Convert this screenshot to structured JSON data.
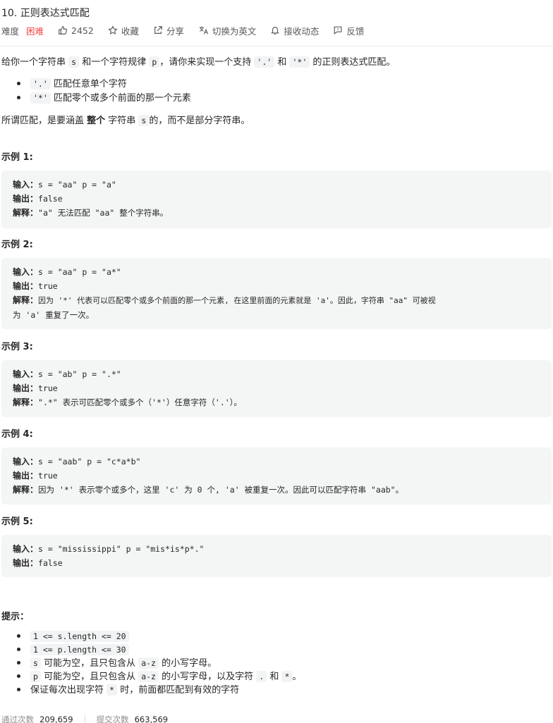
{
  "problem": {
    "title": "10. 正则表达式匹配",
    "difficulty_label": "难度",
    "difficulty": "困难",
    "likes": "2452",
    "favorite_label": "收藏",
    "share_label": "分享",
    "switch_lang_label": "切换为英文",
    "follow_label": "接收动态",
    "feedback_label": "反馈"
  },
  "description": {
    "p1": [
      "给你一个字符串 ",
      "s",
      " 和一个字符规律 ",
      "p",
      "，请你来实现一个支持 ",
      "'.'",
      " 和 ",
      "'*'",
      " 的正则表达式匹配。"
    ],
    "bullets": [
      {
        "code": "'.'",
        "text": " 匹配任意单个字符"
      },
      {
        "code": "'*'",
        "text": " 匹配零个或多个前面的那一个元素"
      }
    ],
    "scope": [
      "所谓匹配，是要涵盖 ",
      "整个",
      " 字符串 ",
      "s",
      "的，而不是部分字符串。"
    ]
  },
  "examples": [
    {
      "title": "示例 1:",
      "lines": [
        {
          "key": "输入：",
          "text": "s = \"aa\" p = \"a\""
        },
        {
          "key": "输出：",
          "text": "false"
        },
        {
          "key": "解释：",
          "text": "\"a\" 无法匹配 \"aa\" 整个字符串。"
        }
      ]
    },
    {
      "title": "示例 2:",
      "lines": [
        {
          "key": "输入：",
          "text": "s = \"aa\" p = \"a*\""
        },
        {
          "key": "输出：",
          "text": "true"
        },
        {
          "key": "解释：",
          "text": "因为 '*' 代表可以匹配零个或多个前面的那一个元素, 在这里前面的元素就是 'a'。因此，字符串 \"aa\" 可被视"
        },
        {
          "key": "",
          "text": "为 'a' 重复了一次。"
        }
      ]
    },
    {
      "title": "示例 3:",
      "lines": [
        {
          "key": "输入：",
          "text": "s = \"ab\" p = \".*\""
        },
        {
          "key": "输出：",
          "text": "true"
        },
        {
          "key": "解释：",
          "text": "\".*\" 表示可匹配零个或多个（'*'）任意字符（'.'）。"
        }
      ]
    },
    {
      "title": "示例 4:",
      "lines": [
        {
          "key": "输入：",
          "text": "s = \"aab\" p = \"c*a*b\""
        },
        {
          "key": "输出：",
          "text": "true"
        },
        {
          "key": "解释：",
          "text": "因为 '*' 表示零个或多个，这里 'c' 为 0 个, 'a' 被重复一次。因此可以匹配字符串 \"aab\"。"
        }
      ]
    },
    {
      "title": "示例 5:",
      "lines": [
        {
          "key": "输入：",
          "text": "s = \"mississippi\" p = \"mis*is*p*.\""
        },
        {
          "key": "输出：",
          "text": "false"
        }
      ]
    }
  ],
  "tips": {
    "title": "提示：",
    "items": [
      {
        "segments": [
          {
            "code": "1 <= s.length <= 20"
          }
        ]
      },
      {
        "segments": [
          {
            "code": "1 <= p.length <= 30"
          }
        ]
      },
      {
        "segments": [
          {
            "code": "s"
          },
          {
            "text": " 可能为空，且只包含从 "
          },
          {
            "code": "a-z"
          },
          {
            "text": " 的小写字母。"
          }
        ]
      },
      {
        "segments": [
          {
            "code": "p"
          },
          {
            "text": " 可能为空，且只包含从 "
          },
          {
            "code": "a-z"
          },
          {
            "text": " 的小写字母，以及字符 "
          },
          {
            "code": "."
          },
          {
            "text": " 和 "
          },
          {
            "code": "*"
          },
          {
            "text": "。"
          }
        ]
      },
      {
        "segments": [
          {
            "text": "保证每次出现字符 "
          },
          {
            "code": "*"
          },
          {
            "text": " 时，前面都匹配到有效的字符"
          }
        ]
      }
    ]
  },
  "stats": {
    "passed_label": "通过次数",
    "passed": "209,659",
    "submitted_label": "提交次数",
    "submitted": "663,569"
  },
  "colors": {
    "hard": "#ef4743",
    "code_bg": "#f2f3f4",
    "pre_bg": "#f4f5f5"
  },
  "icons": [
    "thumbs-up-icon",
    "star-icon",
    "share-icon",
    "translate-icon",
    "bell-icon",
    "feedback-icon"
  ]
}
